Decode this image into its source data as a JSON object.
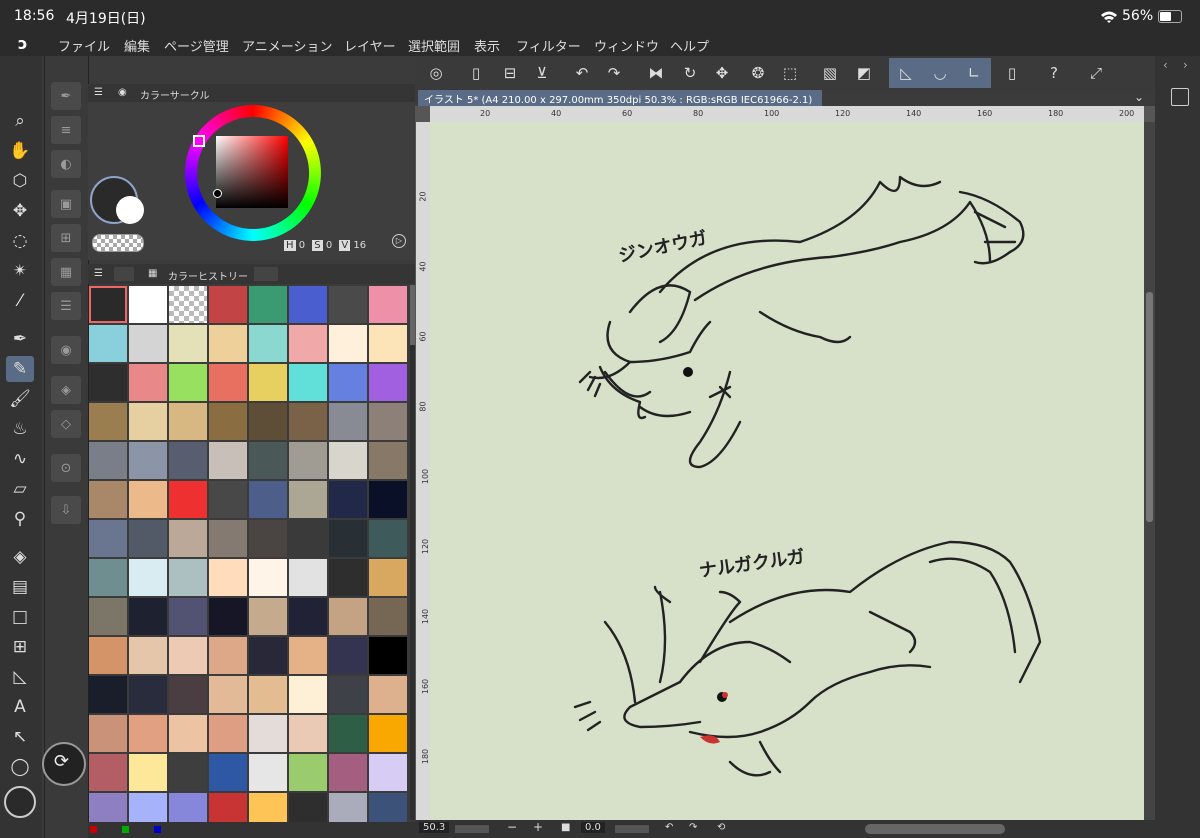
{
  "status": {
    "time": "18:56",
    "date": "4月19日(日)",
    "battery": "56%"
  },
  "menu": {
    "items": [
      "ファイル",
      "編集",
      "ページ管理",
      "アニメーション",
      "レイヤー",
      "選択範囲",
      "表示",
      "フィルター",
      "ウィンドウ",
      "ヘルプ"
    ]
  },
  "color_circle": {
    "title": "カラーサークル",
    "h_label": "H",
    "h_value": "0",
    "s_label": "S",
    "s_value": "0",
    "v_label": "V",
    "v_value": "16"
  },
  "color_history": {
    "title": "カラーヒストリー",
    "swatches": [
      "#2a2a2a",
      "#ffffff",
      "checker",
      "#c24444",
      "#3a9a72",
      "#4a5ed0",
      "#4a4a4a",
      "#ee90a8",
      "#8ad0dc",
      "#d4d4d4",
      "#e4e0b8",
      "#eed09a",
      "#8ad8d0",
      "#f0a8a8",
      "#fff0dc",
      "#fde4b8",
      "#2e2e2e",
      "#e88888",
      "#98e060",
      "#e87060",
      "#e8d060",
      "#60e0d8",
      "#6680e0",
      "#a060e0",
      "#9a7e50",
      "#e6cfa0",
      "#d8b882",
      "#8a6e42",
      "#5e4e38",
      "#7a6248",
      "#888a94",
      "#8c8078",
      "#7a7e88",
      "#8c94a8",
      "#585e70",
      "#c8c0b8",
      "#4a5858",
      "#a09c94",
      "#d8d6cc",
      "#887868",
      "#a88868",
      "#ecba8a",
      "#ee3030",
      "#484848",
      "#4e5e8a",
      "#aca694",
      "#222848",
      "#0a1028",
      "#6a7690",
      "#525a68",
      "#bca898",
      "#847a72",
      "#4a4442",
      "#3a3a3a",
      "#283036",
      "#3e5a5a",
      "#6e8e90",
      "#d8ecf2",
      "#acc0c2",
      "#fedcbc",
      "#fef4e8",
      "#e2e2e2",
      "#2e2e2e",
      "#d8a860",
      "#7c7668",
      "#1e2230",
      "#525272",
      "#161626",
      "#c6aa8e",
      "#222236",
      "#c4a284",
      "#766654",
      "#d49468",
      "#e6c6aa",
      "#eccab4",
      "#dca888",
      "#282838",
      "#e4b286",
      "#343450",
      "#000000",
      "#1a1e2a",
      "#282c3c",
      "#4a3e42",
      "#e2ba98",
      "#e4bc92",
      "#fdf0d6",
      "#3e4248",
      "#ddb08e",
      "#ca9278",
      "#e2a082",
      "#ecc4a4",
      "#de9e84",
      "#e4dcd8",
      "#eacab4",
      "#2e5e46",
      "#f8a800",
      "#b25e64",
      "#fde89a",
      "#3e3e3e",
      "#2e58a4",
      "#e6e6e6",
      "#9acc6e",
      "#a45e80",
      "#d6ccf4",
      "#8e7ec2",
      "#a6b2fa",
      "#8686da",
      "#c83434",
      "#fec456",
      "#2e2e2e",
      "#aaacbc",
      "#3c5278"
    ]
  },
  "document": {
    "tab_title": "イラスト 5* (A4 210.00 x 297.00mm 350dpi 50.3% : RGB:sRGB IEC61966-2.1)",
    "h_ticks": [
      "20",
      "40",
      "60",
      "80",
      "100",
      "120",
      "140",
      "160",
      "180",
      "200"
    ],
    "v_ticks": [
      "20",
      "40",
      "60",
      "80",
      "100",
      "120",
      "140",
      "160",
      "180"
    ],
    "label_top": "ジンオウガ",
    "label_bottom": "ナルガクルガ"
  },
  "bottom": {
    "zoom": "50.3",
    "angle": "0.0",
    "minus": "−",
    "plus": "+"
  }
}
